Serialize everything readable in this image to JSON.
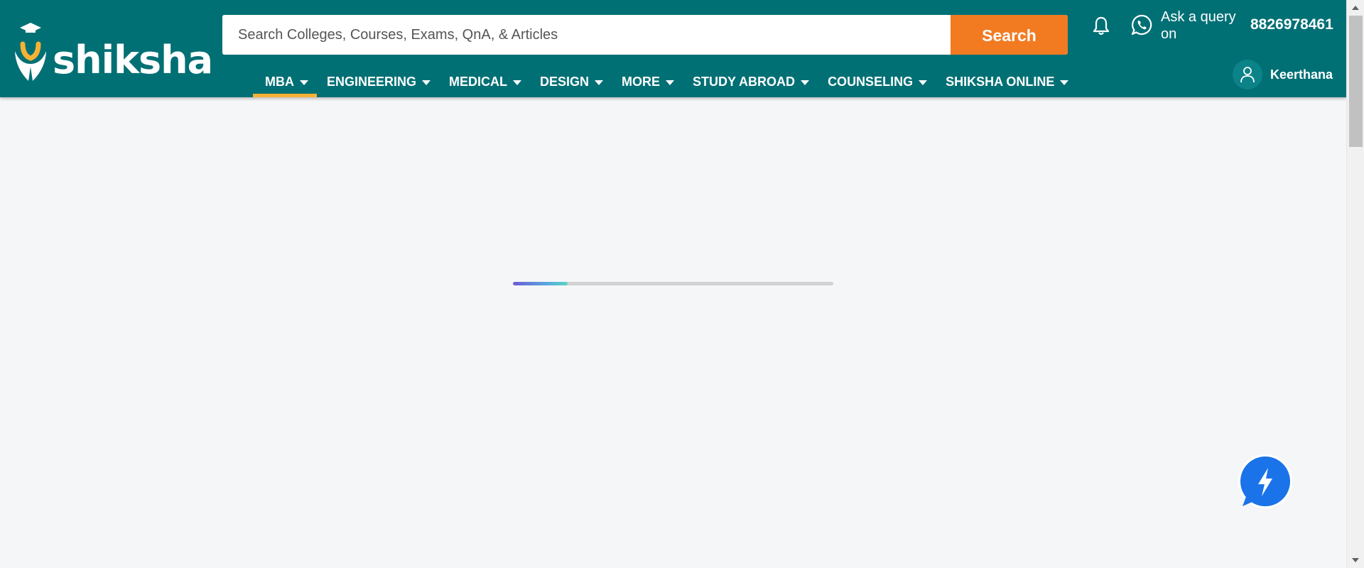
{
  "brand": {
    "name": "shiksha",
    "colors": {
      "header_bg": "#007075",
      "accent": "#f27b22",
      "nav_active": "#f7b134",
      "chat_fab": "#1a73e8"
    }
  },
  "search": {
    "placeholder": "Search Colleges, Courses, Exams, QnA, & Articles",
    "value": "",
    "button_label": "Search",
    "icon": "search-icon"
  },
  "header": {
    "notification_icon": "bell-icon",
    "whatsapp_icon": "whatsapp-icon",
    "ask_query_text": "Ask a query on",
    "phone": "8826978461"
  },
  "nav": {
    "items": [
      {
        "label": "MBA",
        "active": true
      },
      {
        "label": "ENGINEERING",
        "active": false
      },
      {
        "label": "MEDICAL",
        "active": false
      },
      {
        "label": "DESIGN",
        "active": false
      },
      {
        "label": "MORE",
        "active": false
      },
      {
        "label": "STUDY ABROAD",
        "active": false
      },
      {
        "label": "COUNSELING",
        "active": false
      },
      {
        "label": "SHIKSHA ONLINE",
        "active": false
      }
    ]
  },
  "user": {
    "name": "Keerthana",
    "avatar_icon": "user-icon"
  },
  "loading": {
    "progress": 0.17
  },
  "chat": {
    "icon": "lightning-chat-icon"
  }
}
